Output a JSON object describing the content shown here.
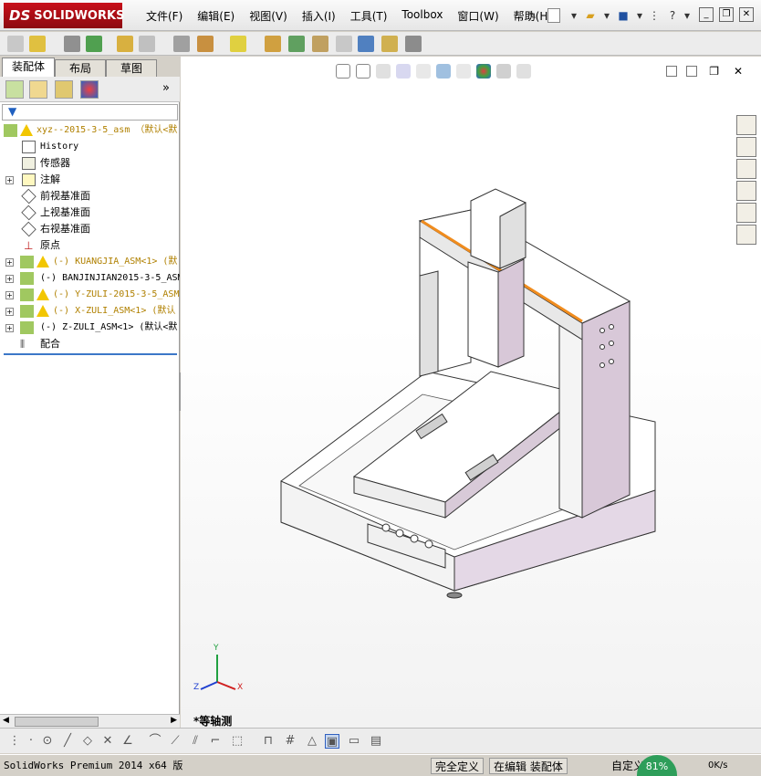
{
  "app": {
    "logo_brand": "SOLIDWORKS",
    "logo_prefix": "DS"
  },
  "menu": [
    {
      "label": "文件(F)"
    },
    {
      "label": "编辑(E)"
    },
    {
      "label": "视图(V)"
    },
    {
      "label": "插入(I)"
    },
    {
      "label": "工具(T)"
    },
    {
      "label": "Toolbox"
    },
    {
      "label": "窗口(W)"
    },
    {
      "label": "帮助(H)"
    }
  ],
  "tabs": [
    {
      "label": "装配体"
    },
    {
      "label": "布局"
    },
    {
      "label": "草图"
    }
  ],
  "feature_tree": {
    "root": "xyz--2015-3-5_asm （默认<默",
    "items": [
      {
        "label": "History"
      },
      {
        "label": "传感器"
      },
      {
        "label": "注解"
      },
      {
        "label": "前视基准面"
      },
      {
        "label": "上视基准面"
      },
      {
        "label": "右视基准面"
      },
      {
        "label": "原点"
      },
      {
        "label": "(-) KUANGJIA_ASM<1> (默"
      },
      {
        "label": "(-) BANJINJIAN2015-3-5_ASM"
      },
      {
        "label": "(-) Y-ZULI-2015-3-5_ASM"
      },
      {
        "label": "(-) X-ZULI_ASM<1> (默认"
      },
      {
        "label": "(-) Z-ZULI_ASM<1> (默认<默"
      },
      {
        "label": "配合"
      }
    ]
  },
  "viewport": {
    "view_label": "*等轴测",
    "axis_labels": {
      "x": "X",
      "y": "Y",
      "z": "Z"
    }
  },
  "statusbar": {
    "product": "SolidWorks Premium 2014 x64 版",
    "definition": "完全定义",
    "mode": "在编辑 装配体",
    "custom": "自定义",
    "net_percent": "81%",
    "net_speed": "0K/s"
  },
  "colors": {
    "brand_red": "#c8101a",
    "accent_orange": "#f08c1e",
    "frame_lavender": "#d8c8d8",
    "selection_blue": "#3c78c8"
  }
}
